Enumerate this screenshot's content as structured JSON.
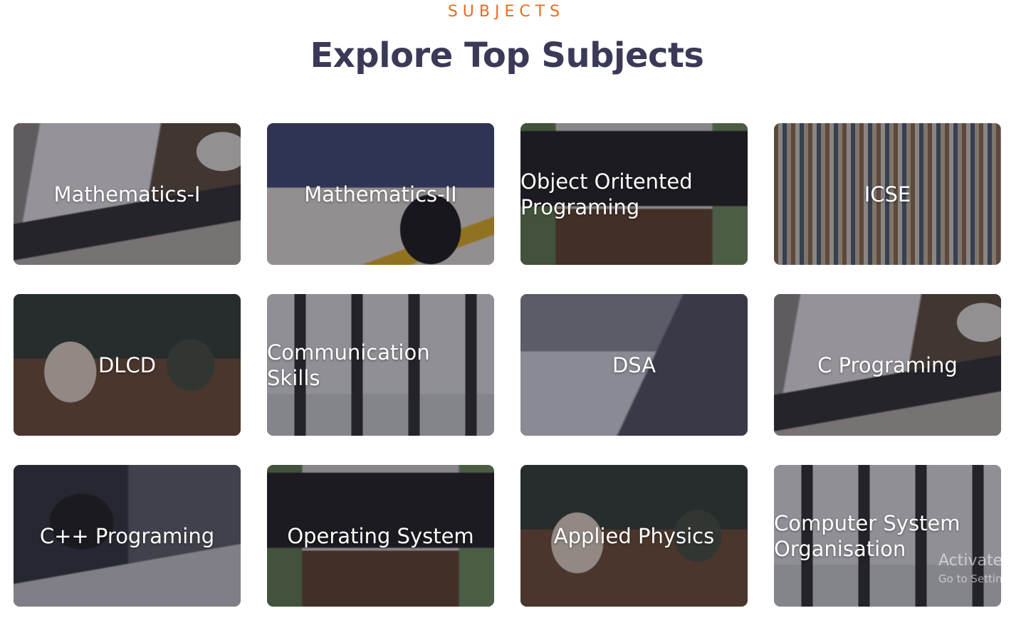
{
  "header": {
    "eyebrow": "SUBJECTS",
    "title": "Explore Top Subjects"
  },
  "subjects": [
    {
      "label": "Mathematics-I",
      "scene": "laptop",
      "align": "center"
    },
    {
      "label": "Mathematics-II",
      "scene": "grad",
      "align": "center"
    },
    {
      "label": "Object Oritented Programing",
      "scene": "desk",
      "align": "left"
    },
    {
      "label": "ICSE",
      "scene": "library",
      "align": "center"
    },
    {
      "label": "DLCD",
      "scene": "cafe",
      "align": "center"
    },
    {
      "label": "Communication Skills",
      "scene": "group",
      "align": "left"
    },
    {
      "label": "DSA",
      "scene": "sketch",
      "align": "center"
    },
    {
      "label": "C Programing",
      "scene": "laptop",
      "align": "center"
    },
    {
      "label": "C++ Programing",
      "scene": "study",
      "align": "center"
    },
    {
      "label": "Operating System",
      "scene": "desk",
      "align": "center"
    },
    {
      "label": "Applied Physics",
      "scene": "cafe",
      "align": "center"
    },
    {
      "label": "Computer System Organisation",
      "scene": "group",
      "align": "left"
    }
  ],
  "watermark": {
    "line1": "Activate Windows",
    "line2": "Go to Settings to activate Windows."
  },
  "colors": {
    "accent": "#ee6a1f",
    "title": "#3a3a58"
  }
}
